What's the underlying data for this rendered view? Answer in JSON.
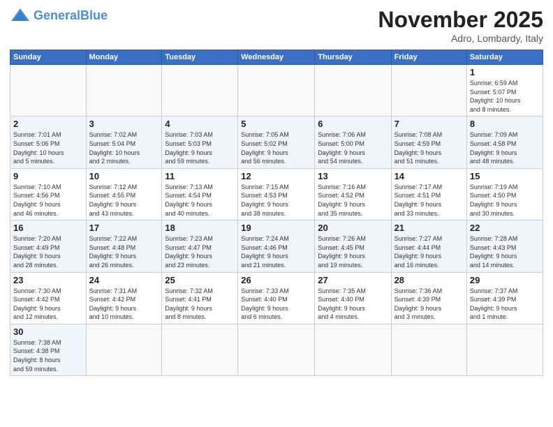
{
  "header": {
    "logo_general": "General",
    "logo_blue": "Blue",
    "month_title": "November 2025",
    "location": "Adro, Lombardy, Italy"
  },
  "weekdays": [
    "Sunday",
    "Monday",
    "Tuesday",
    "Wednesday",
    "Thursday",
    "Friday",
    "Saturday"
  ],
  "weeks": [
    [
      {
        "day": "",
        "info": ""
      },
      {
        "day": "",
        "info": ""
      },
      {
        "day": "",
        "info": ""
      },
      {
        "day": "",
        "info": ""
      },
      {
        "day": "",
        "info": ""
      },
      {
        "day": "",
        "info": ""
      },
      {
        "day": "1",
        "info": "Sunrise: 6:59 AM\nSunset: 5:07 PM\nDaylight: 10 hours\nand 8 minutes."
      }
    ],
    [
      {
        "day": "2",
        "info": "Sunrise: 7:01 AM\nSunset: 5:06 PM\nDaylight: 10 hours\nand 5 minutes."
      },
      {
        "day": "3",
        "info": "Sunrise: 7:02 AM\nSunset: 5:04 PM\nDaylight: 10 hours\nand 2 minutes."
      },
      {
        "day": "4",
        "info": "Sunrise: 7:03 AM\nSunset: 5:03 PM\nDaylight: 9 hours\nand 59 minutes."
      },
      {
        "day": "5",
        "info": "Sunrise: 7:05 AM\nSunset: 5:02 PM\nDaylight: 9 hours\nand 56 minutes."
      },
      {
        "day": "6",
        "info": "Sunrise: 7:06 AM\nSunset: 5:00 PM\nDaylight: 9 hours\nand 54 minutes."
      },
      {
        "day": "7",
        "info": "Sunrise: 7:08 AM\nSunset: 4:59 PM\nDaylight: 9 hours\nand 51 minutes."
      },
      {
        "day": "8",
        "info": "Sunrise: 7:09 AM\nSunset: 4:58 PM\nDaylight: 9 hours\nand 48 minutes."
      }
    ],
    [
      {
        "day": "9",
        "info": "Sunrise: 7:10 AM\nSunset: 4:56 PM\nDaylight: 9 hours\nand 46 minutes."
      },
      {
        "day": "10",
        "info": "Sunrise: 7:12 AM\nSunset: 4:55 PM\nDaylight: 9 hours\nand 43 minutes."
      },
      {
        "day": "11",
        "info": "Sunrise: 7:13 AM\nSunset: 4:54 PM\nDaylight: 9 hours\nand 40 minutes."
      },
      {
        "day": "12",
        "info": "Sunrise: 7:15 AM\nSunset: 4:53 PM\nDaylight: 9 hours\nand 38 minutes."
      },
      {
        "day": "13",
        "info": "Sunrise: 7:16 AM\nSunset: 4:52 PM\nDaylight: 9 hours\nand 35 minutes."
      },
      {
        "day": "14",
        "info": "Sunrise: 7:17 AM\nSunset: 4:51 PM\nDaylight: 9 hours\nand 33 minutes."
      },
      {
        "day": "15",
        "info": "Sunrise: 7:19 AM\nSunset: 4:50 PM\nDaylight: 9 hours\nand 30 minutes."
      }
    ],
    [
      {
        "day": "16",
        "info": "Sunrise: 7:20 AM\nSunset: 4:49 PM\nDaylight: 9 hours\nand 28 minutes."
      },
      {
        "day": "17",
        "info": "Sunrise: 7:22 AM\nSunset: 4:48 PM\nDaylight: 9 hours\nand 26 minutes."
      },
      {
        "day": "18",
        "info": "Sunrise: 7:23 AM\nSunset: 4:47 PM\nDaylight: 9 hours\nand 23 minutes."
      },
      {
        "day": "19",
        "info": "Sunrise: 7:24 AM\nSunset: 4:46 PM\nDaylight: 9 hours\nand 21 minutes."
      },
      {
        "day": "20",
        "info": "Sunrise: 7:26 AM\nSunset: 4:45 PM\nDaylight: 9 hours\nand 19 minutes."
      },
      {
        "day": "21",
        "info": "Sunrise: 7:27 AM\nSunset: 4:44 PM\nDaylight: 9 hours\nand 16 minutes."
      },
      {
        "day": "22",
        "info": "Sunrise: 7:28 AM\nSunset: 4:43 PM\nDaylight: 9 hours\nand 14 minutes."
      }
    ],
    [
      {
        "day": "23",
        "info": "Sunrise: 7:30 AM\nSunset: 4:42 PM\nDaylight: 9 hours\nand 12 minutes."
      },
      {
        "day": "24",
        "info": "Sunrise: 7:31 AM\nSunset: 4:42 PM\nDaylight: 9 hours\nand 10 minutes."
      },
      {
        "day": "25",
        "info": "Sunrise: 7:32 AM\nSunset: 4:41 PM\nDaylight: 9 hours\nand 8 minutes."
      },
      {
        "day": "26",
        "info": "Sunrise: 7:33 AM\nSunset: 4:40 PM\nDaylight: 9 hours\nand 6 minutes."
      },
      {
        "day": "27",
        "info": "Sunrise: 7:35 AM\nSunset: 4:40 PM\nDaylight: 9 hours\nand 4 minutes."
      },
      {
        "day": "28",
        "info": "Sunrise: 7:36 AM\nSunset: 4:39 PM\nDaylight: 9 hours\nand 3 minutes."
      },
      {
        "day": "29",
        "info": "Sunrise: 7:37 AM\nSunset: 4:39 PM\nDaylight: 9 hours\nand 1 minute."
      }
    ],
    [
      {
        "day": "30",
        "info": "Sunrise: 7:38 AM\nSunset: 4:38 PM\nDaylight: 8 hours\nand 59 minutes."
      },
      {
        "day": "",
        "info": ""
      },
      {
        "day": "",
        "info": ""
      },
      {
        "day": "",
        "info": ""
      },
      {
        "day": "",
        "info": ""
      },
      {
        "day": "",
        "info": ""
      },
      {
        "day": "",
        "info": ""
      }
    ]
  ]
}
